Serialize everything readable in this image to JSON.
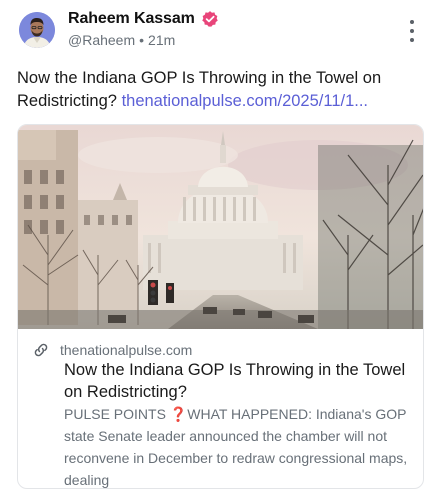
{
  "author": {
    "name": "Raheem Kassam",
    "handle": "@Raheem",
    "separator": "•",
    "time": "21m",
    "verified": true,
    "avatar_icon": "avatar-portrait-icon"
  },
  "post": {
    "text": "Now the Indiana GOP Is Throwing in the Towel on Redistricting?",
    "link_text": "thenationalpulse.com/2025/11/1..."
  },
  "card": {
    "image_icon": "us-capitol-photo",
    "domain": "thenationalpulse.com",
    "title": "Now the Indiana GOP Is Throwing in the Towel on Redistricting?",
    "description": "PULSE POINTS ❓WHAT HAPPENED: Indiana's GOP state Senate leader announced the chamber will not reconvene in December to redraw congressional maps, dealing"
  },
  "icons": {
    "verified": "verified-badge-icon",
    "more": "more-vertical-icon",
    "link": "link-icon"
  },
  "colors": {
    "accent": "#5b5fd6",
    "verified": "#e8457a",
    "muted": "#687078"
  }
}
